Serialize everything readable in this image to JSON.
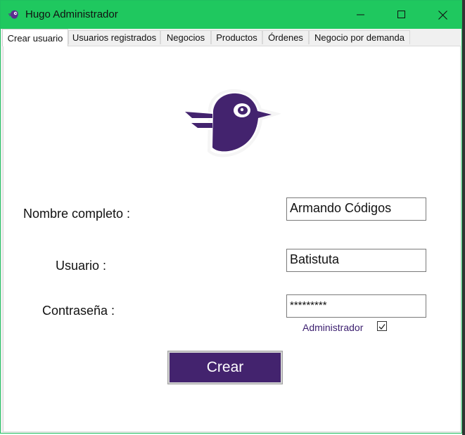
{
  "window": {
    "title": "Hugo Administrador",
    "accent_color": "#1fc85f",
    "controls": [
      "minimize-icon",
      "maximize-icon",
      "close-icon"
    ]
  },
  "tabs": [
    {
      "label": "Crear usuario",
      "active": true
    },
    {
      "label": "Usuarios registrados",
      "active": false
    },
    {
      "label": "Negocios",
      "active": false
    },
    {
      "label": "Productos",
      "active": false
    },
    {
      "label": "Órdenes",
      "active": false
    },
    {
      "label": "Negocio por demanda",
      "active": false
    }
  ],
  "form": {
    "logo": "bird-logo-icon",
    "brand_color": "#43236e",
    "name_label": "Nombre completo :",
    "name_value": "Armando Códigos",
    "user_label": "Usuario :",
    "user_value": "Batistuta",
    "password_label": "Contraseña :",
    "password_value": "*********",
    "admin_label": "Administrador",
    "admin_checked": true,
    "submit_label": "Crear"
  }
}
